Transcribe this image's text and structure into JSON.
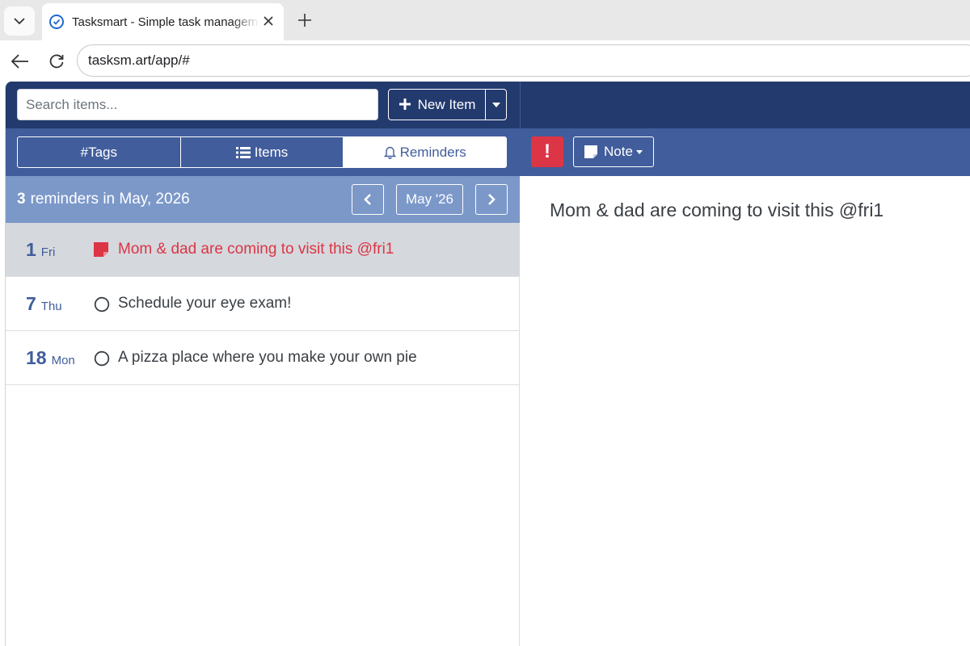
{
  "browser": {
    "tab_title": "Tasksmart - Simple task management",
    "url": "tasksm.art/app/#"
  },
  "app": {
    "search": {
      "placeholder": "Search items..."
    },
    "new_item_label": "New Item",
    "tabs": [
      {
        "label": "#Tags",
        "icon": "hash",
        "active": false
      },
      {
        "label": "Items",
        "icon": "list-icon",
        "active": false
      },
      {
        "label": "Reminders",
        "icon": "bell-icon",
        "active": true
      }
    ],
    "month_header": {
      "count": "3",
      "label": "reminders in May, 2026",
      "current": "May '26"
    },
    "reminders": [
      {
        "day": "1",
        "dow": "Fri",
        "text": "Mom & dad are coming to visit this @fri1",
        "icon": "note-icon",
        "selected": true
      },
      {
        "day": "7",
        "dow": "Thu",
        "text": "Schedule your eye exam!",
        "icon": "circle-icon",
        "selected": false
      },
      {
        "day": "18",
        "dow": "Mon",
        "text": "A pizza place where you make your own pie",
        "icon": "circle-icon",
        "selected": false
      }
    ],
    "detail": {
      "priority_label": "!",
      "type_label": "Note",
      "text": "Mom & dad are coming to visit this @fri1"
    },
    "colors": {
      "navy": "#233a6e",
      "blue": "#415d9b",
      "light_blue": "#7b98c9",
      "danger": "#dc3545",
      "selected_row": "#d5d8dd"
    }
  }
}
